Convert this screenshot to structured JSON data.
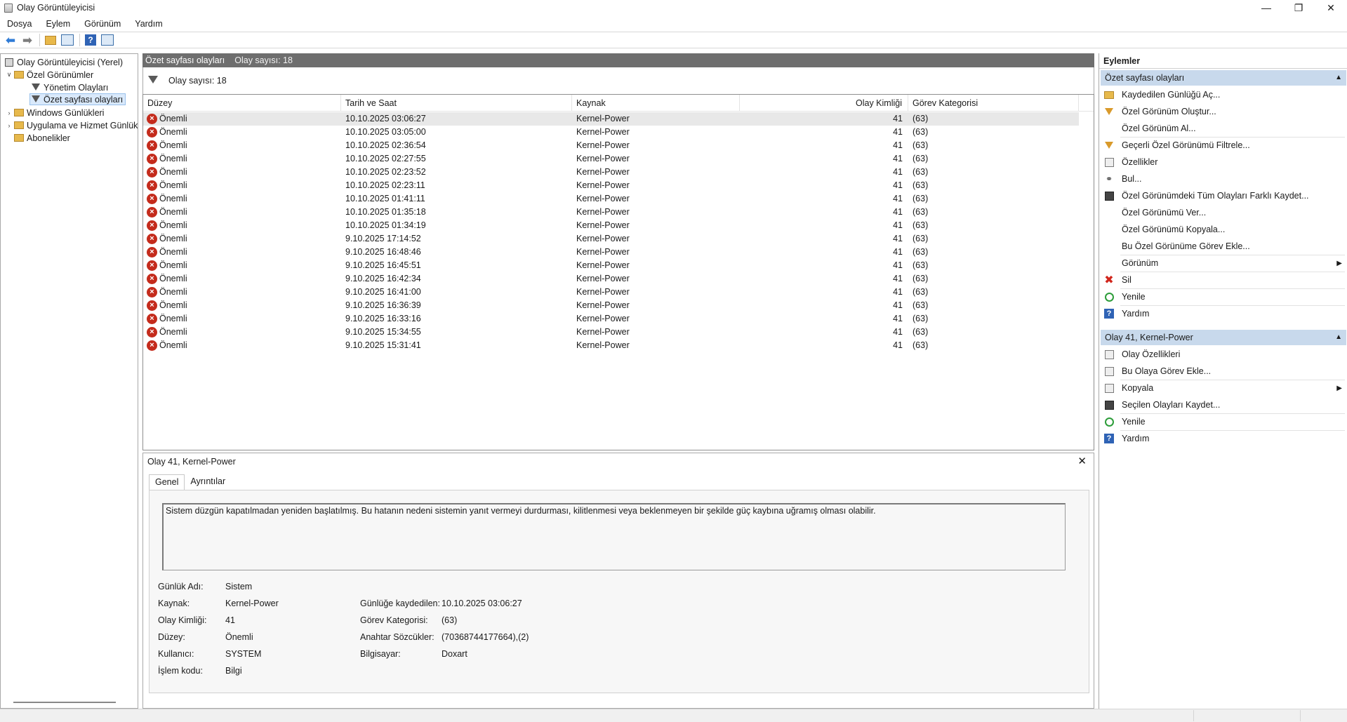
{
  "window": {
    "title": "Olay Görüntüleyicisi",
    "minimize": "—",
    "maximize": "❐",
    "close": "✕"
  },
  "menu": [
    "Dosya",
    "Eylem",
    "Görünüm",
    "Yardım"
  ],
  "tree": {
    "root": "Olay Görüntüleyicisi (Yerel)",
    "custom_views": "Özel Görünümler",
    "admin_events": "Yönetim Olayları",
    "summary_events": "Özet sayfası olayları",
    "windows_logs": "Windows Günlükleri",
    "app_service_logs": "Uygulama ve Hizmet Günlük",
    "subscriptions": "Abonelikler"
  },
  "center": {
    "header_title": "Özet sayfası olayları",
    "header_count": "Olay sayısı: 18",
    "filter_text": "Olay sayısı: 18"
  },
  "table": {
    "columns": {
      "level": "Düzey",
      "datetime": "Tarih ve Saat",
      "source": "Kaynak",
      "event_id": "Olay Kimliği",
      "task_category": "Görev Kategorisi"
    },
    "rows": [
      {
        "level": "Önemli",
        "datetime": "10.10.2025 03:06:27",
        "source": "Kernel-Power",
        "event_id": "41",
        "task_category": "(63)"
      },
      {
        "level": "Önemli",
        "datetime": "10.10.2025 03:05:00",
        "source": "Kernel-Power",
        "event_id": "41",
        "task_category": "(63)"
      },
      {
        "level": "Önemli",
        "datetime": "10.10.2025 02:36:54",
        "source": "Kernel-Power",
        "event_id": "41",
        "task_category": "(63)"
      },
      {
        "level": "Önemli",
        "datetime": "10.10.2025 02:27:55",
        "source": "Kernel-Power",
        "event_id": "41",
        "task_category": "(63)"
      },
      {
        "level": "Önemli",
        "datetime": "10.10.2025 02:23:52",
        "source": "Kernel-Power",
        "event_id": "41",
        "task_category": "(63)"
      },
      {
        "level": "Önemli",
        "datetime": "10.10.2025 02:23:11",
        "source": "Kernel-Power",
        "event_id": "41",
        "task_category": "(63)"
      },
      {
        "level": "Önemli",
        "datetime": "10.10.2025 01:41:11",
        "source": "Kernel-Power",
        "event_id": "41",
        "task_category": "(63)"
      },
      {
        "level": "Önemli",
        "datetime": "10.10.2025 01:35:18",
        "source": "Kernel-Power",
        "event_id": "41",
        "task_category": "(63)"
      },
      {
        "level": "Önemli",
        "datetime": "10.10.2025 01:34:19",
        "source": "Kernel-Power",
        "event_id": "41",
        "task_category": "(63)"
      },
      {
        "level": "Önemli",
        "datetime": "9.10.2025 17:14:52",
        "source": "Kernel-Power",
        "event_id": "41",
        "task_category": "(63)"
      },
      {
        "level": "Önemli",
        "datetime": "9.10.2025 16:48:46",
        "source": "Kernel-Power",
        "event_id": "41",
        "task_category": "(63)"
      },
      {
        "level": "Önemli",
        "datetime": "9.10.2025 16:45:51",
        "source": "Kernel-Power",
        "event_id": "41",
        "task_category": "(63)"
      },
      {
        "level": "Önemli",
        "datetime": "9.10.2025 16:42:34",
        "source": "Kernel-Power",
        "event_id": "41",
        "task_category": "(63)"
      },
      {
        "level": "Önemli",
        "datetime": "9.10.2025 16:41:00",
        "source": "Kernel-Power",
        "event_id": "41",
        "task_category": "(63)"
      },
      {
        "level": "Önemli",
        "datetime": "9.10.2025 16:36:39",
        "source": "Kernel-Power",
        "event_id": "41",
        "task_category": "(63)"
      },
      {
        "level": "Önemli",
        "datetime": "9.10.2025 16:33:16",
        "source": "Kernel-Power",
        "event_id": "41",
        "task_category": "(63)"
      },
      {
        "level": "Önemli",
        "datetime": "9.10.2025 15:34:55",
        "source": "Kernel-Power",
        "event_id": "41",
        "task_category": "(63)"
      },
      {
        "level": "Önemli",
        "datetime": "9.10.2025 15:31:41",
        "source": "Kernel-Power",
        "event_id": "41",
        "task_category": "(63)"
      }
    ]
  },
  "detail": {
    "title": "Olay 41, Kernel-Power",
    "tabs": [
      "Genel",
      "Ayrıntılar"
    ],
    "description": "Sistem düzgün kapatılmadan yeniden başlatılmış. Bu hatanın nedeni sistemin yanıt vermeyi durdurması, kilitlenmesi veya beklenmeyen bir şekilde güç kaybına uğramış olması olabilir.",
    "fields": {
      "log_name_label": "Günlük Adı:",
      "log_name": "Sistem",
      "source_label": "Kaynak:",
      "source": "Kernel-Power",
      "logged_label": "Günlüğe kaydedilen:",
      "logged": "10.10.2025 03:06:27",
      "event_id_label": "Olay Kimliği:",
      "event_id": "41",
      "task_label": "Görev Kategorisi:",
      "task": "(63)",
      "level_label": "Düzey:",
      "level": "Önemli",
      "keywords_label": "Anahtar Sözcükler:",
      "keywords": "(70368744177664),(2)",
      "user_label": "Kullanıcı:",
      "user": "SYSTEM",
      "computer_label": "Bilgisayar:",
      "computer": "Doxart",
      "opcode_label": "İşlem kodu:",
      "opcode": "Bilgi"
    }
  },
  "actions": {
    "title": "Eylemler",
    "section1": "Özet sayfası olayları",
    "section1_items": [
      {
        "label": "Kaydedilen Günlüğü Aç...",
        "icon": "folder-icon"
      },
      {
        "label": "Özel Görünüm Oluştur...",
        "icon": "filter-icon"
      },
      {
        "label": "Özel Görünüm Al...",
        "icon": "none"
      },
      {
        "label": "Geçerli Özel Görünümü Filtrele...",
        "icon": "filter-icon"
      },
      {
        "label": "Özellikler",
        "icon": "properties-icon"
      },
      {
        "label": "Bul...",
        "icon": "binoculars-icon"
      },
      {
        "label": "Özel Görünümdeki Tüm Olayları Farklı Kaydet...",
        "icon": "save-icon"
      },
      {
        "label": "Özel Görünümü Ver...",
        "icon": "none"
      },
      {
        "label": "Özel Görünümü Kopyala...",
        "icon": "none"
      },
      {
        "label": "Bu Özel Görünüme Görev Ekle...",
        "icon": "none"
      },
      {
        "label": "Görünüm",
        "icon": "none"
      },
      {
        "label": "Sil",
        "icon": "delete-icon"
      },
      {
        "label": "Yenile",
        "icon": "refresh-icon"
      },
      {
        "label": "Yardım",
        "icon": "help-icon"
      }
    ],
    "section2": "Olay 41, Kernel-Power",
    "section2_items": [
      {
        "label": "Olay Özellikleri",
        "icon": "properties-icon"
      },
      {
        "label": "Bu Olaya Görev Ekle...",
        "icon": "task-icon"
      },
      {
        "label": "Kopyala",
        "icon": "copy-icon"
      },
      {
        "label": "Seçilen Olayları Kaydet...",
        "icon": "save-icon"
      },
      {
        "label": "Yenile",
        "icon": "refresh-icon"
      },
      {
        "label": "Yardım",
        "icon": "help-icon"
      }
    ]
  },
  "colors": {
    "header_bg": "#6e6e6e",
    "section_bg": "#c8d9ec",
    "error_red": "#c42b1c",
    "selection": "#d9e9fb"
  }
}
